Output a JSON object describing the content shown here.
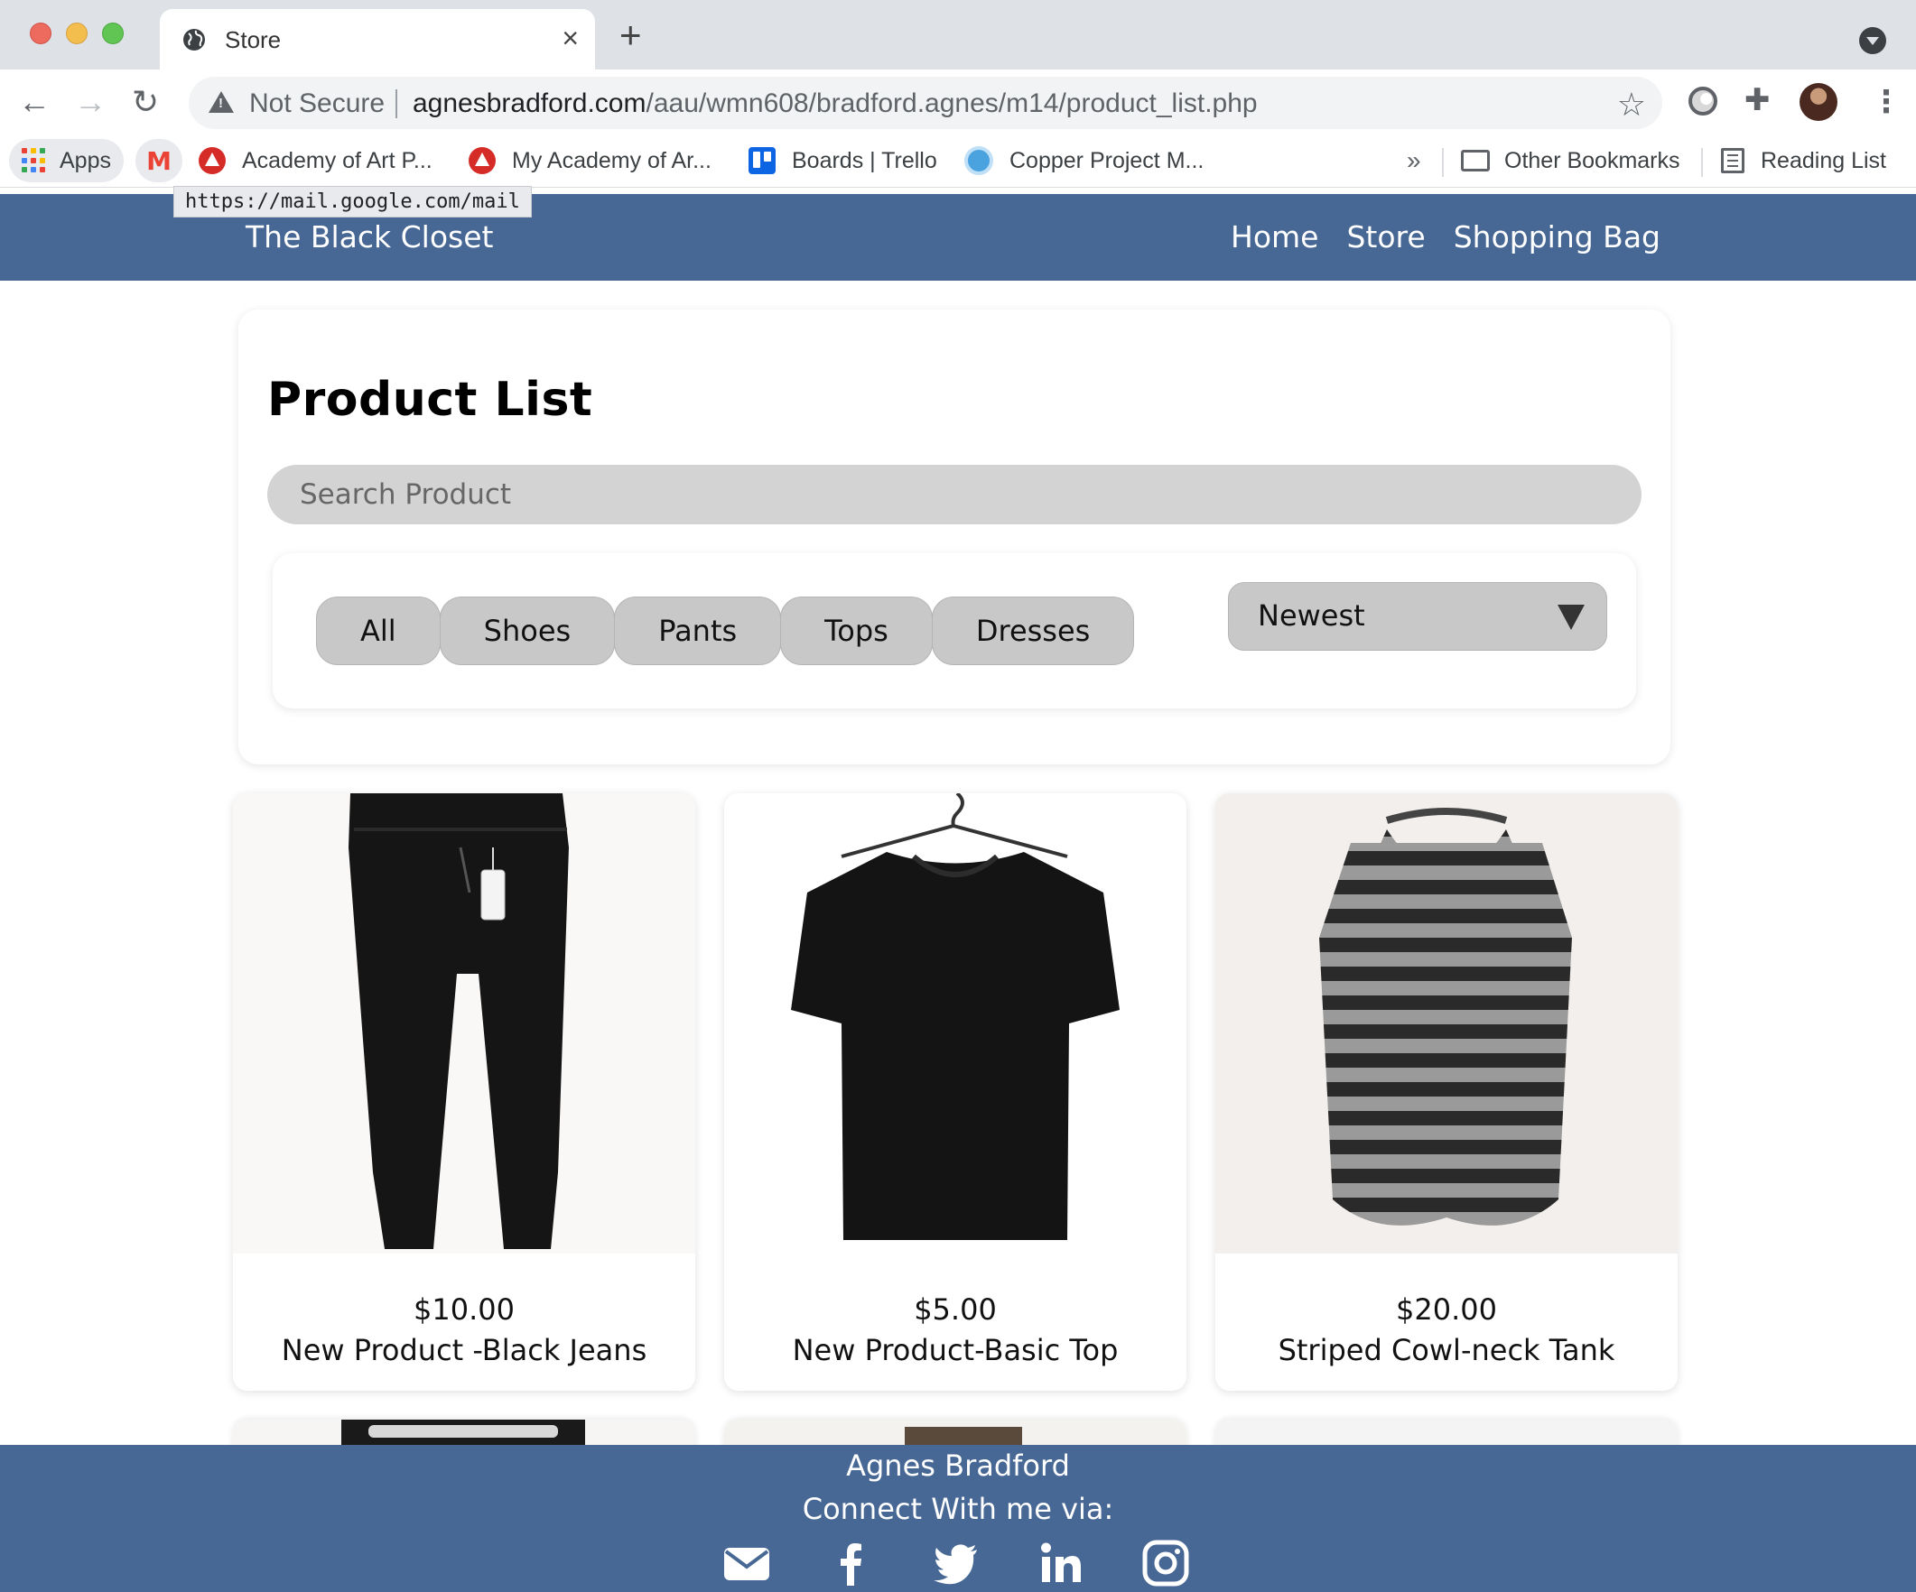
{
  "browser": {
    "tab_title": "Store",
    "new_tab": "+",
    "close": "×",
    "security_label": "Not Secure",
    "url_domain": "agnesbradford.com",
    "url_path": "/aau/wmn608/bradford.agnes/m14/product_list.php",
    "bookmarks": {
      "apps": "Apps",
      "items": [
        "Academy of Art P...",
        "My Academy of Ar...",
        "Boards | Trello",
        "Copper Project M..."
      ],
      "more": "»",
      "other": "Other Bookmarks",
      "reading_list": "Reading List"
    },
    "tooltip": "https://mail.google.com/mail"
  },
  "site": {
    "brand": "The Black Closet",
    "nav": [
      "Home",
      "Store",
      "Shopping Bag"
    ],
    "accent_color": "#476794"
  },
  "page": {
    "title": "Product List",
    "search_placeholder": "Search Product",
    "categories": [
      "All",
      "Shoes",
      "Pants",
      "Tops",
      "Dresses"
    ],
    "sort_selected": "Newest"
  },
  "products": [
    {
      "price": "$10.00",
      "name": "New Product -Black Jeans",
      "image": "black-jeans"
    },
    {
      "price": "$5.00",
      "name": "New Product-Basic Top",
      "image": "black-tshirt"
    },
    {
      "price": "$20.00",
      "name": "Striped Cowl-neck Tank",
      "image": "striped-tank"
    }
  ],
  "footer": {
    "name": "Agnes Bradford",
    "connect": "Connect With me via:",
    "social_icons": [
      "envelope-icon",
      "facebook-icon",
      "twitter-icon",
      "linkedin-icon",
      "instagram-icon"
    ]
  }
}
